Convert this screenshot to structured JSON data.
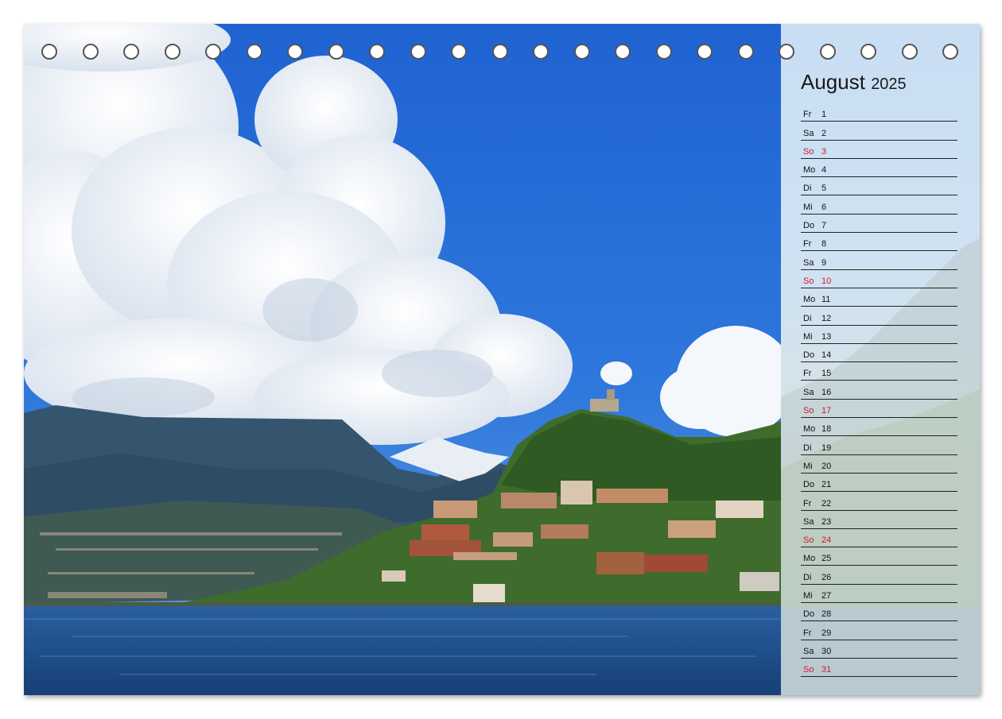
{
  "calendar": {
    "month": "August",
    "year": "2025",
    "ring_count": 23,
    "sunday_color": "#d0192b",
    "days": [
      {
        "wd": "Fr",
        "num": "1"
      },
      {
        "wd": "Sa",
        "num": "2"
      },
      {
        "wd": "So",
        "num": "3",
        "sunday": true
      },
      {
        "wd": "Mo",
        "num": "4"
      },
      {
        "wd": "Di",
        "num": "5"
      },
      {
        "wd": "Mi",
        "num": "6"
      },
      {
        "wd": "Do",
        "num": "7"
      },
      {
        "wd": "Fr",
        "num": "8"
      },
      {
        "wd": "Sa",
        "num": "9"
      },
      {
        "wd": "So",
        "num": "10",
        "sunday": true
      },
      {
        "wd": "Mo",
        "num": "11"
      },
      {
        "wd": "Di",
        "num": "12"
      },
      {
        "wd": "Mi",
        "num": "13"
      },
      {
        "wd": "Do",
        "num": "14"
      },
      {
        "wd": "Fr",
        "num": "15"
      },
      {
        "wd": "Sa",
        "num": "16"
      },
      {
        "wd": "So",
        "num": "17",
        "sunday": true
      },
      {
        "wd": "Mo",
        "num": "18"
      },
      {
        "wd": "Di",
        "num": "19"
      },
      {
        "wd": "Mi",
        "num": "20"
      },
      {
        "wd": "Do",
        "num": "21"
      },
      {
        "wd": "Fr",
        "num": "22"
      },
      {
        "wd": "Sa",
        "num": "23"
      },
      {
        "wd": "So",
        "num": "24",
        "sunday": true
      },
      {
        "wd": "Mo",
        "num": "25"
      },
      {
        "wd": "Di",
        "num": "26"
      },
      {
        "wd": "Mi",
        "num": "27"
      },
      {
        "wd": "Do",
        "num": "28"
      },
      {
        "wd": "Fr",
        "num": "29"
      },
      {
        "wd": "Sa",
        "num": "30"
      },
      {
        "wd": "So",
        "num": "31",
        "sunday": true
      }
    ]
  }
}
